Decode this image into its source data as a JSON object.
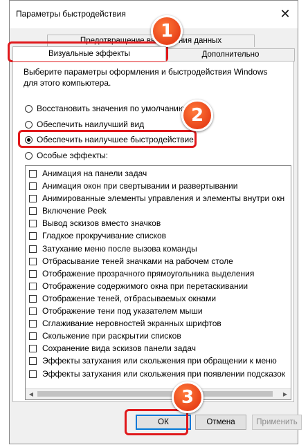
{
  "window": {
    "title": "Параметры быстродействия",
    "close_icon": "✕"
  },
  "tabs": {
    "prevention": "Предотвращение выполнения данных",
    "visual_effects": "Визуальные эффекты",
    "advanced": "Дополнительно"
  },
  "description": "Выберите параметры оформления и быстродействия Windows для этого компьютера.",
  "options": {
    "restore_defaults": "Восстановить значения по умолчанию",
    "best_appearance": "Обеспечить наилучший вид",
    "best_performance": "Обеспечить наилучшее быстродействие",
    "custom": "Особые эффекты:"
  },
  "effects": [
    "Анимация на панели задач",
    "Анимация окон при свертывании и развертывании",
    "Анимированные элементы управления и элементы внутри окн",
    "Включение Peek",
    "Вывод эскизов вместо значков",
    "Гладкое прокручивание списков",
    "Затухание меню после вызова команды",
    "Отбрасывание теней значками на рабочем столе",
    "Отображение прозрачного прямоугольника выделения",
    "Отображение содержимого окна при перетаскивании",
    "Отображение теней, отбрасываемых окнами",
    "Отображение тени под указателем мыши",
    "Сглаживание неровностей экранных шрифтов",
    "Скольжение при раскрытии списков",
    "Сохранение вида эскизов панели задач",
    "Эффекты затухания или скольжения при обращении к меню",
    "Эффекты затухания или скольжения при появлении подсказок"
  ],
  "buttons": {
    "ok": "ОК",
    "cancel": "Отмена",
    "apply": "Применить"
  },
  "annotations": {
    "step1": "1",
    "step2": "2",
    "step3": "3"
  },
  "colors": {
    "highlight": "#e0181b",
    "badge": "#e8431a",
    "ok_border": "#0078d7"
  }
}
